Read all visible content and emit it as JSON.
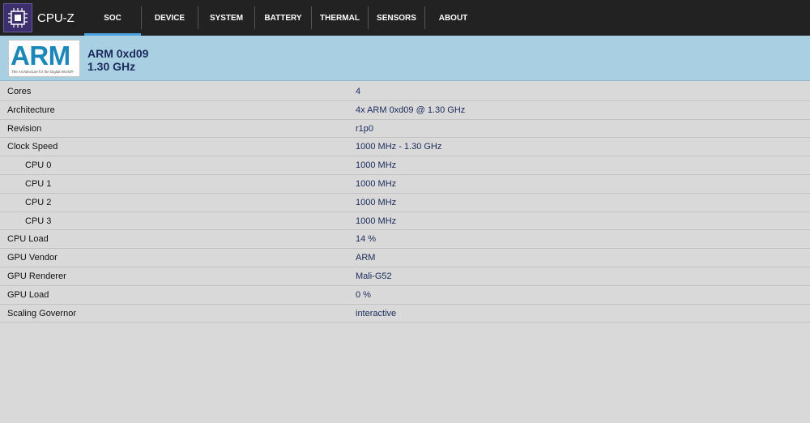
{
  "app": {
    "title": "CPU-Z",
    "icon": "chip-icon"
  },
  "tabs": [
    {
      "label": "SOC",
      "active": true
    },
    {
      "label": "DEVICE",
      "active": false
    },
    {
      "label": "SYSTEM",
      "active": false
    },
    {
      "label": "BATTERY",
      "active": false
    },
    {
      "label": "THERMAL",
      "active": false
    },
    {
      "label": "SENSORS",
      "active": false
    },
    {
      "label": "ABOUT",
      "active": false
    }
  ],
  "header": {
    "logo_word": "ARM",
    "logo_tagline": "The Architecture for the Digital World®",
    "name": "ARM 0xd09",
    "speed": "1.30 GHz"
  },
  "rows": [
    {
      "label": "Cores",
      "value": "4"
    },
    {
      "label": "Architecture",
      "value": "4x ARM 0xd09 @ 1.30 GHz"
    },
    {
      "label": "Revision",
      "value": "r1p0"
    },
    {
      "label": "Clock Speed",
      "value": "1000 MHz - 1.30 GHz"
    },
    {
      "label": "CPU 0",
      "value": "1000 MHz"
    },
    {
      "label": "CPU 1",
      "value": "1000 MHz"
    },
    {
      "label": "CPU 2",
      "value": "1000 MHz"
    },
    {
      "label": "CPU 3",
      "value": "1000 MHz"
    },
    {
      "label": "CPU Load",
      "value": "14 %"
    },
    {
      "label": "GPU Vendor",
      "value": "ARM"
    },
    {
      "label": "GPU Renderer",
      "value": "Mali-G52"
    },
    {
      "label": "GPU Load",
      "value": "0 %"
    },
    {
      "label": "Scaling Governor",
      "value": "interactive"
    }
  ],
  "colors": {
    "topbar": "#222222",
    "accent": "#4aa3df",
    "header_bg": "#a8cfe2",
    "page_bg": "#d9d9d9",
    "value_text": "#1a2a5a"
  }
}
